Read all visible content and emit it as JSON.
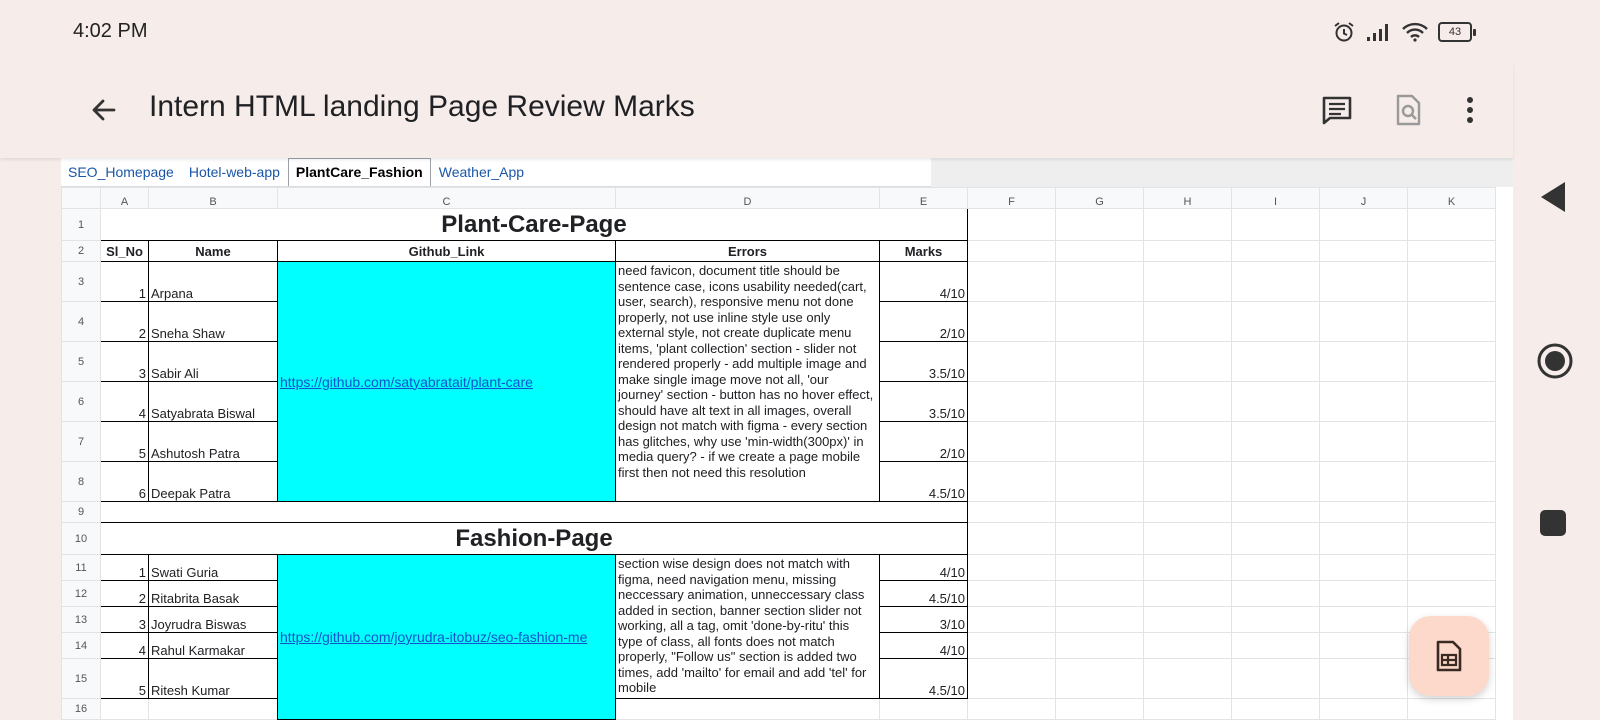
{
  "status": {
    "time": "4:02 PM",
    "battery": "43"
  },
  "appbar": {
    "title": "Intern HTML landing Page Review Marks"
  },
  "sheet": {
    "name_partial": "Intern HTML landing Page Review Marks",
    "tabs": [
      "SEO_Homepage",
      "Hotel-web-app",
      "PlantCare_Fashion",
      "Weather_App"
    ],
    "active_tab": "PlantCare_Fashion",
    "columns": [
      "A",
      "B",
      "C",
      "D",
      "E",
      "F",
      "G",
      "H",
      "I",
      "J",
      "K"
    ],
    "row_numbers": [
      "1",
      "2",
      "3",
      "4",
      "5",
      "6",
      "7",
      "8",
      "9",
      "10",
      "11",
      "12",
      "13",
      "14",
      "15",
      "16"
    ],
    "plant": {
      "title": "Plant-Care-Page",
      "headers": {
        "sl": "Sl_No",
        "name": "Name",
        "link": "Github_Link",
        "errors": "Errors",
        "marks": "Marks"
      },
      "rows": [
        {
          "sl": "1",
          "name": "Arpana",
          "marks": "4/10"
        },
        {
          "sl": "2",
          "name": "Sneha Shaw",
          "marks": "2/10"
        },
        {
          "sl": "3",
          "name": "Sabir Ali",
          "marks": "3.5/10"
        },
        {
          "sl": "4",
          "name": "Satyabrata Biswal",
          "marks": "3.5/10"
        },
        {
          "sl": "5",
          "name": "Ashutosh Patra",
          "marks": "2/10"
        },
        {
          "sl": "6",
          "name": "Deepak Patra",
          "marks": "4.5/10"
        }
      ],
      "link": "https://github.com/satyabratait/plant-care",
      "errors": "need favicon, document title should be sentence case, icons usability needed(cart, user, search), responsive menu not done properly, not use inline style use only external style, not create duplicate menu items, 'plant collection' section - slider not rendered properly - add multiple image and make single image move not all, 'our journey' section - button has no hover effect, should have alt text in all images, overall design not match with figma - every section has glitches, why use 'min-width(300px)' in media query? - if we create a page mobile first then not need this resolution"
    },
    "fashion": {
      "title": "Fashion-Page",
      "rows": [
        {
          "sl": "1",
          "name": "Swati Guria",
          "marks": "4/10"
        },
        {
          "sl": "2",
          "name": "Ritabrita Basak",
          "marks": "4.5/10"
        },
        {
          "sl": "3",
          "name": "Joyrudra Biswas",
          "marks": "3/10"
        },
        {
          "sl": "4",
          "name": "Rahul Karmakar",
          "marks": "4/10"
        },
        {
          "sl": "5",
          "name": "Ritesh Kumar",
          "marks": "4.5/10"
        }
      ],
      "link": "https://github.com/joyrudra-itobuz/seo-fashion-me",
      "errors": "section wise design does not match with figma, need navigation menu, missing neccessary animation, unneccessary class added in section, banner section slider not working, all a tag, omit 'done-by-ritu' this type of class, all fonts does not match properly, \"Follow us\" section is added two times, add 'mailto' for email and add 'tel' for mobile"
    }
  }
}
